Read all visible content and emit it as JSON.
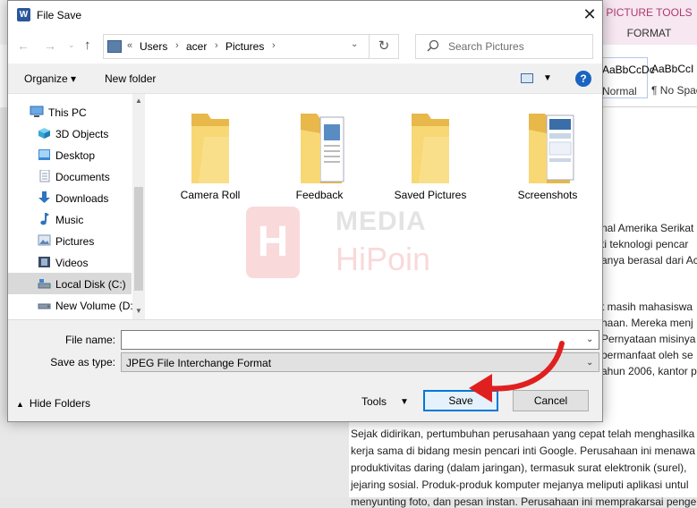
{
  "dialog": {
    "title": "File Save",
    "close_glyph": "✕"
  },
  "navigation": {
    "back_glyph": "←",
    "forward_glyph": "→",
    "recent_glyph": "⌄",
    "up_glyph": "↑",
    "breadcrumb_prefix": "«",
    "breadcrumb": [
      "Users",
      "acer",
      "Pictures"
    ],
    "separator": "›",
    "refresh_glyph": "↻",
    "search_placeholder": "Search Pictures"
  },
  "toolbar": {
    "organize_label": "Organize ▾",
    "new_folder_label": "New folder",
    "view_caret": "▼",
    "help_label": "?"
  },
  "nav_tree": {
    "items": [
      {
        "label": "This PC",
        "icon": "computer-icon",
        "color": "#3c7fc7"
      },
      {
        "label": "3D Objects",
        "icon": "cube-icon",
        "color": "#3aa4d6"
      },
      {
        "label": "Desktop",
        "icon": "desktop-icon",
        "color": "#3a8ad6"
      },
      {
        "label": "Documents",
        "icon": "documents-icon",
        "color": "#8a9bb0"
      },
      {
        "label": "Downloads",
        "icon": "download-icon",
        "color": "#2f74c0"
      },
      {
        "label": "Music",
        "icon": "music-icon",
        "color": "#2f74c0"
      },
      {
        "label": "Pictures",
        "icon": "pictures-icon",
        "color": "#7d95b3"
      },
      {
        "label": "Videos",
        "icon": "videos-icon",
        "color": "#3a4a63"
      },
      {
        "label": "Local Disk (C:)",
        "icon": "drive-icon",
        "color": "#5a6a80"
      },
      {
        "label": "New Volume (D:",
        "icon": "drive-icon",
        "color": "#5a6a80"
      }
    ],
    "selected_index": 8,
    "scroll_up_glyph": "▲",
    "scroll_down_glyph": "▼"
  },
  "folders": [
    {
      "label": "Camera Roll",
      "type": "plain"
    },
    {
      "label": "Feedback",
      "type": "docs"
    },
    {
      "label": "Saved Pictures",
      "type": "plain"
    },
    {
      "label": "Screenshots",
      "type": "screens"
    }
  ],
  "watermark": {
    "logo": "H",
    "line1": "MEDIA",
    "line2": "HiPoin"
  },
  "fields": {
    "filename_label": "File name:",
    "filename_value": "",
    "savetype_label": "Save as type:",
    "savetype_value": "JPEG File Interchange Format",
    "caret": "⌄"
  },
  "footer": {
    "hide_folders_glyph": "▲",
    "hide_folders_label": "Hide Folders",
    "tools_label": "Tools",
    "tools_caret": "▼",
    "save_label": "Save",
    "cancel_label": "Cancel"
  },
  "word_background": {
    "picture_tools_label": "PICTURE TOOLS",
    "format_tab": "FORMAT",
    "style1_preview": "AaBbCcDc",
    "style1_name": "Normal",
    "style2_preview": "AaBbCcI",
    "style2_name": "¶ No Spac",
    "lines_right": [
      "nal Amerika Serikat",
      "ti teknologi pencar",
      "anya berasal dari Ac",
      "",
      "t masih mahasiswa",
      "haan. Mereka menj",
      "Pernyataan misinya",
      "bermanfaat oleh se",
      "ahun 2006, kantor p"
    ],
    "lines_full": [
      "Sejak didirikan, pertumbuhan perusahaan yang cepat telah menghasilka",
      "kerja sama di bidang mesin pencari inti Google. Perusahaan ini menawa",
      "produktivitas daring (dalam jaringan), termasuk surat elektronik (surel),",
      "jejaring sosial. Produk-produk komputer mejanya meliputi aplikasi untul",
      "menyunting foto, dan pesan instan. Perusahaan ini memprakarsai penge"
    ]
  }
}
